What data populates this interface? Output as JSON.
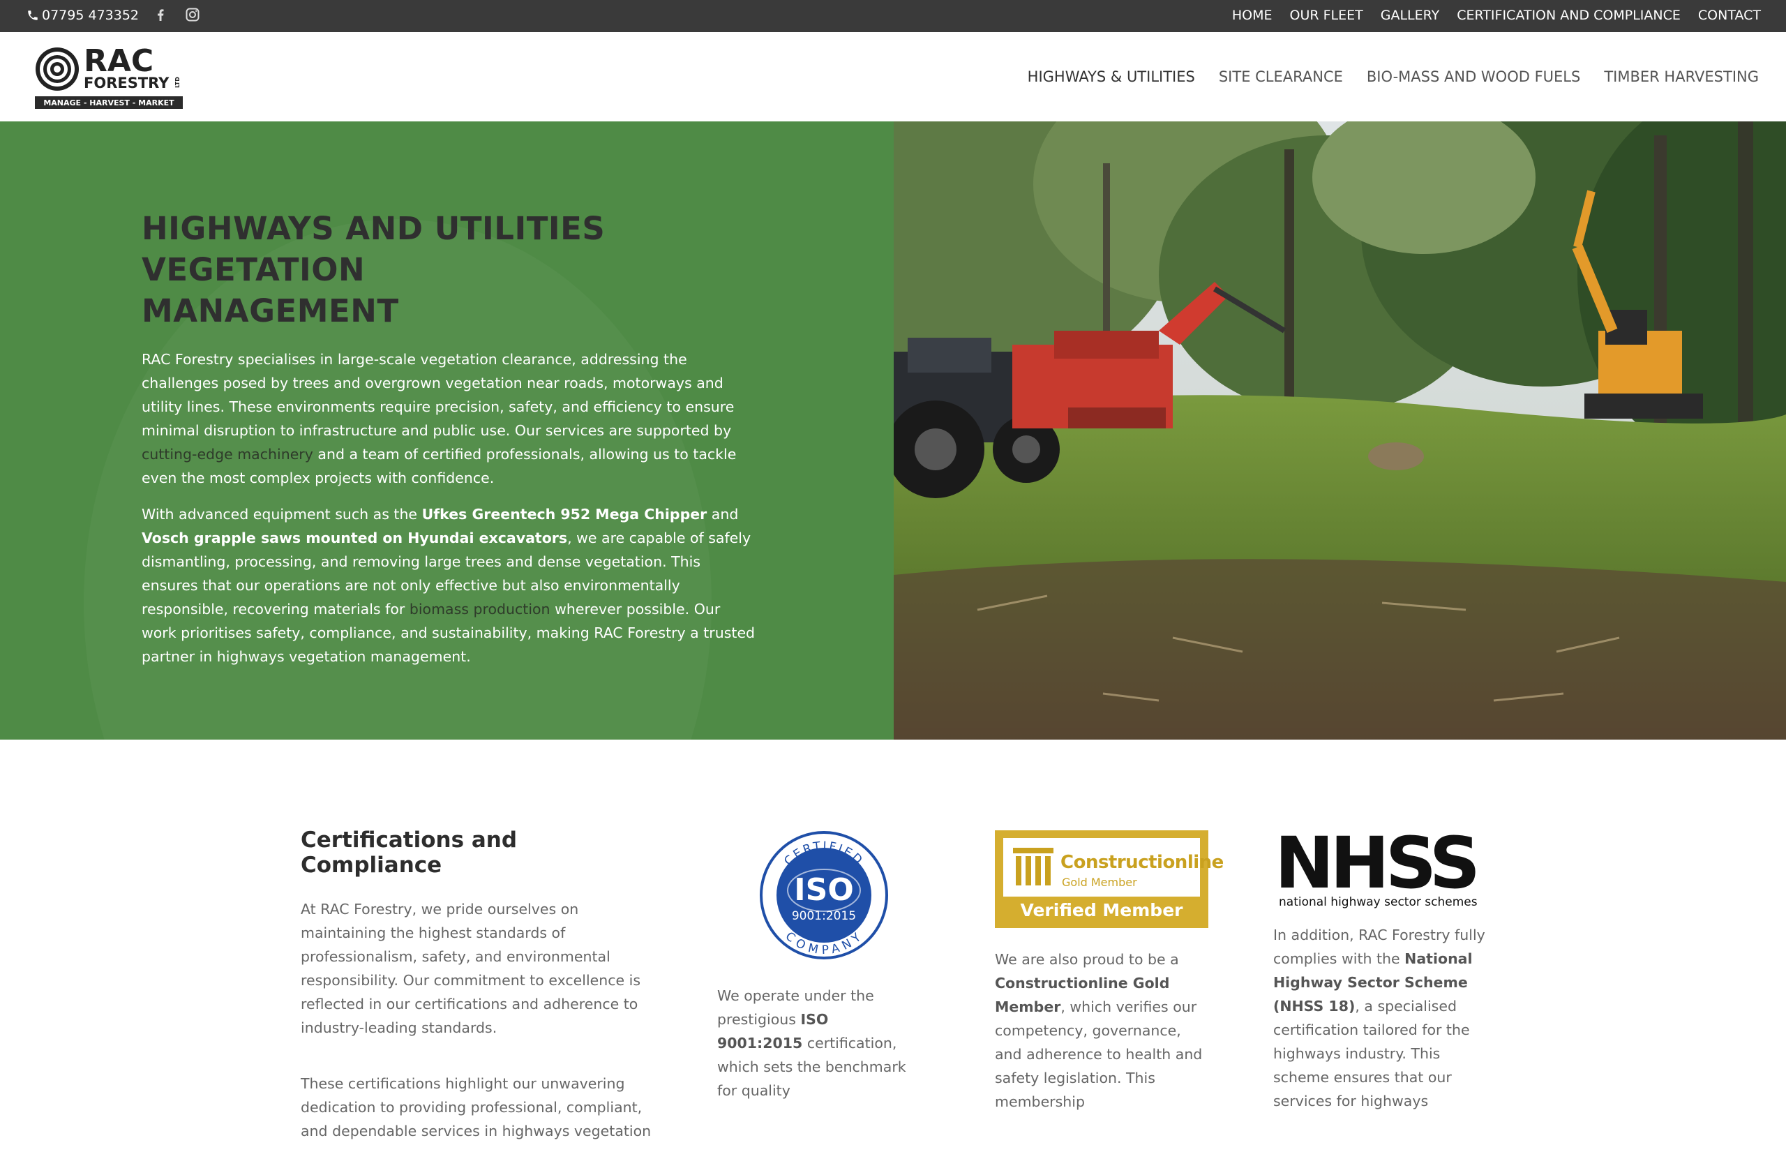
{
  "topbar": {
    "phone": "07795 473352",
    "social": [
      "facebook-icon",
      "instagram-icon"
    ],
    "nav": [
      "HOME",
      "OUR FLEET",
      "GALLERY",
      "CERTIFICATION AND COMPLIANCE",
      "CONTACT"
    ]
  },
  "logo": {
    "line1": "RAC",
    "line2": "FORESTRY",
    "ltd": "LTD",
    "tagline": "MANAGE - HARVEST - MARKET"
  },
  "mainnav": [
    "HIGHWAYS & UTILITIES",
    "SITE CLEARANCE",
    "BIO-MASS AND WOOD FUELS",
    "TIMBER HARVESTING"
  ],
  "hero": {
    "title_lines": [
      "HIGHWAYS AND UTILITIES",
      "VEGETATION",
      "MANAGEMENT"
    ],
    "p1_a": "RAC Forestry specialises in large-scale vegetation clearance, addressing the challenges posed by trees and overgrown vegetation near roads, motorways and utility lines. These environments require precision, safety, and efficiency to ensure minimal disruption to infrastructure and public use. Our services are supported by ",
    "p1_link": "cutting-edge machinery",
    "p1_b": " and a team of certified professionals, allowing us to tackle even the most complex projects with confidence.",
    "p2_a": "With advanced equipment such as the ",
    "p2_bold1": "Ufkes Greentech 952 Mega Chipper",
    "p2_and": " and ",
    "p2_bold2": "Vosch grapple saws mounted on Hyundai excavators",
    "p2_b": ", we are capable of safely dismantling, processing, and removing large trees and dense vegetation. This ensures that our operations are not only effective but also environmentally responsible, recovering materials for ",
    "p2_link": "biomass production",
    "p2_c": " wherever possible. Our work prioritises safety, compliance, and sustainability, making RAC Forestry a trusted partner in highways vegetation management."
  },
  "certs": {
    "title": "Certifications and Compliance",
    "intro_p1": "At RAC Forestry, we pride ourselves on maintaining the highest standards of professionalism, safety, and environmental responsibility. Our commitment to excellence is reflected in our certifications and adherence to industry-leading standards.",
    "intro_p2": "These certifications highlight our unwavering dedication to providing professional, compliant, and dependable services in highways vegetation",
    "iso": {
      "badge_top": "CERTIFIED",
      "badge_main": "ISO",
      "badge_num": "9001:2015",
      "badge_bottom": "COMPANY",
      "text_a": "We operate under the prestigious ",
      "text_bold": "ISO 9001:2015",
      "text_b": " certification, which sets the benchmark for quality"
    },
    "constructionline": {
      "badge_name": "Constructionline",
      "badge_gold": "Gold Member",
      "badge_verified": "Verified Member",
      "text_a": "We are also proud to be a ",
      "text_bold": "Constructionline Gold Member",
      "text_b": ", which verifies our competency, governance, and adherence to health and safety legislation. This membership"
    },
    "nhss": {
      "logo_text": "NHSS",
      "logo_sub": "national highway sector schemes",
      "text_a": "In addition, RAC Forestry fully complies with the ",
      "text_bold": "National Highway Sector Scheme (NHSS 18)",
      "text_b": ", a specialised certification tailored for the highways industry. This scheme ensures that our services for highways"
    }
  },
  "colors": {
    "topbar_bg": "#3a3a3a",
    "hero_green": "#4f8b46",
    "gold": "#d5ae2f",
    "iso_blue": "#1f4fa8"
  }
}
